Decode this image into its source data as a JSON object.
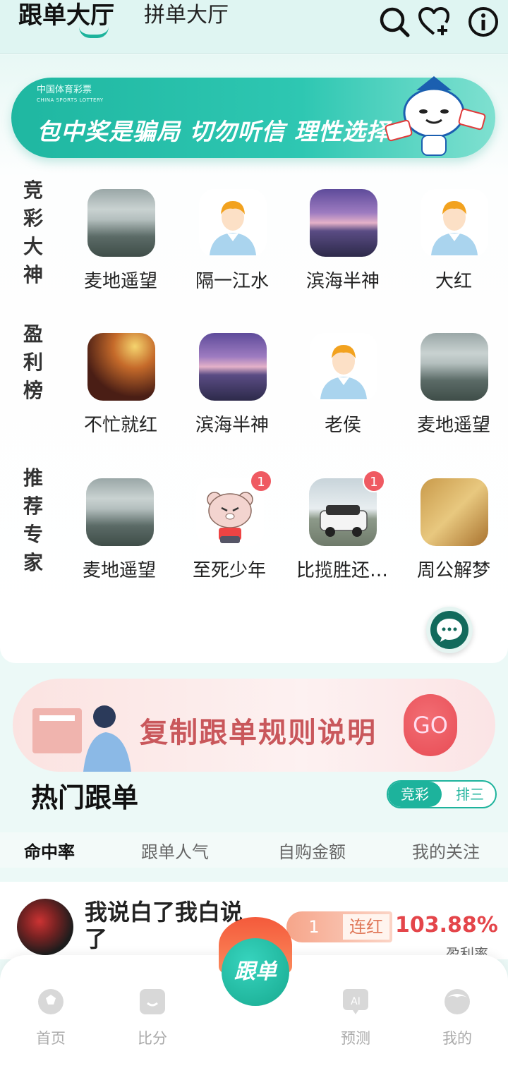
{
  "header": {
    "tab_active": "跟单大厅",
    "tab_second": "拼单大厅"
  },
  "banner": {
    "logo_text": "中国体育彩票",
    "logo_sub": "CHINA SPORTS LOTTERY",
    "slogan": "包中奖是骗局 切勿听信 理性选择"
  },
  "sections": [
    {
      "label": [
        "竞",
        "彩",
        "大",
        "神"
      ],
      "experts": [
        {
          "name": "麦地遥望",
          "avatar": "mountain"
        },
        {
          "name": "隔一江水",
          "avatar": "person"
        },
        {
          "name": "滨海半神",
          "avatar": "sea"
        },
        {
          "name": "大红",
          "avatar": "person"
        }
      ]
    },
    {
      "label": [
        "盈",
        "利",
        "榜"
      ],
      "experts": [
        {
          "name": "不忙就红",
          "avatar": "concert"
        },
        {
          "name": "滨海半神",
          "avatar": "sea"
        },
        {
          "name": "老侯",
          "avatar": "person"
        },
        {
          "name": "麦地遥望",
          "avatar": "mountain"
        }
      ]
    },
    {
      "label": [
        "推",
        "荐",
        "专",
        "家"
      ],
      "experts": [
        {
          "name": "麦地遥望",
          "avatar": "mountain"
        },
        {
          "name": "至死少年",
          "avatar": "bear",
          "badge": "1"
        },
        {
          "name": "比揽胜还…",
          "avatar": "car",
          "badge": "1"
        },
        {
          "name": "周公解梦",
          "avatar": "dream"
        }
      ]
    }
  ],
  "rule_banner": {
    "text": "复制跟单规则说明",
    "go": "GO"
  },
  "hot": {
    "title": "热门跟单",
    "toggle_on": "竞彩",
    "toggle_off": "排三"
  },
  "filters": [
    "命中率",
    "跟单人气",
    "自购金额",
    "我的关注"
  ],
  "item": {
    "name": "我说白了我白说了",
    "streak_count": "1",
    "streak_label": "连红",
    "rate": "103.88%",
    "rate_label": "盈利率"
  },
  "tabbar": {
    "home": "首页",
    "score": "比分",
    "center": "跟单",
    "predict": "预测",
    "mine": "我的"
  }
}
